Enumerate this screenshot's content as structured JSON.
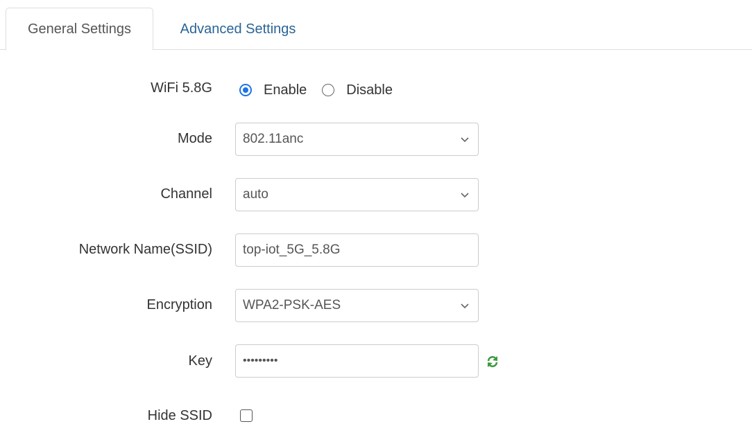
{
  "tabs": [
    {
      "label": "General Settings",
      "active": true
    },
    {
      "label": "Advanced Settings",
      "active": false
    }
  ],
  "form": {
    "wifi": {
      "label": "WiFi 5.8G",
      "options": [
        "Enable",
        "Disable"
      ],
      "selected": "Enable"
    },
    "mode": {
      "label": "Mode",
      "value": "802.11anc"
    },
    "channel": {
      "label": "Channel",
      "value": "auto"
    },
    "ssid": {
      "label": "Network Name(SSID)",
      "value": "top-iot_5G_5.8G"
    },
    "encryption": {
      "label": "Encryption",
      "value": "WPA2-PSK-AES"
    },
    "key": {
      "label": "Key",
      "value": "•••••••••",
      "icon": "refresh-icon"
    },
    "hide_ssid": {
      "label": "Hide SSID",
      "checked": false
    }
  },
  "colors": {
    "accent": "#1a73e8",
    "tab_link": "#2a6496",
    "refresh_icon": "#3c9a3c"
  }
}
